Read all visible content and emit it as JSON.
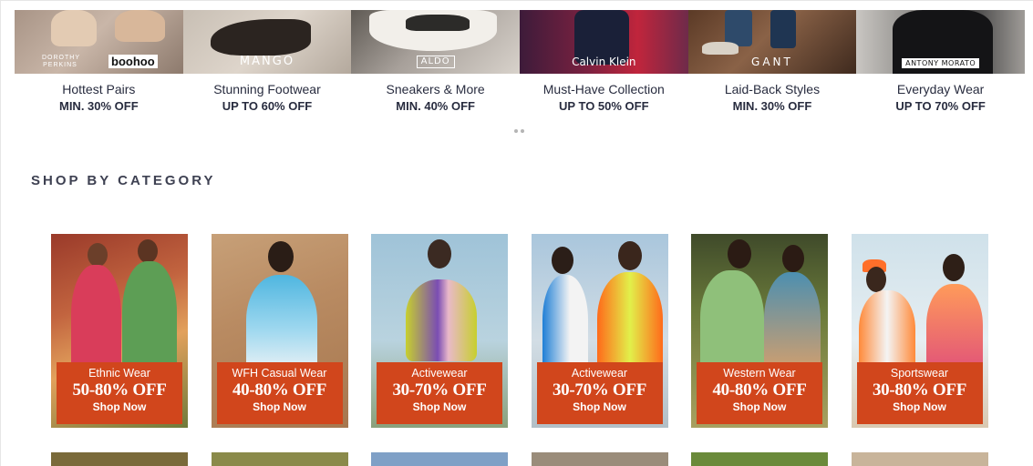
{
  "brands": [
    {
      "logo": "boohoo",
      "logo_secondary": "DOROTHY PERKINS",
      "title": "Hottest Pairs",
      "offer": "MIN. 30% OFF"
    },
    {
      "logo": "MANGO",
      "title": "Stunning Footwear",
      "offer": "UP TO 60% OFF"
    },
    {
      "logo": "ALDO",
      "title": "Sneakers & More",
      "offer": "MIN. 40% OFF"
    },
    {
      "logo": "Calvin Klein",
      "title": "Must-Have Collection",
      "offer": "UP TO 50% OFF"
    },
    {
      "logo": "GANT",
      "title": "Laid-Back Styles",
      "offer": "MIN. 30% OFF"
    },
    {
      "logo": "ANTONY MORATO",
      "title": "Everyday Wear",
      "offer": "UP TO 70% OFF"
    }
  ],
  "section_title": "SHOP BY CATEGORY",
  "categories": [
    {
      "name": "Ethnic Wear",
      "discount": "50-80% OFF",
      "cta": "Shop Now"
    },
    {
      "name": "WFH Casual Wear",
      "discount": "40-80% OFF",
      "cta": "Shop Now"
    },
    {
      "name": "Activewear",
      "discount": "30-70% OFF",
      "cta": "Shop Now"
    },
    {
      "name": "Activewear",
      "discount": "30-70% OFF",
      "cta": "Shop Now"
    },
    {
      "name": "Western Wear",
      "discount": "40-80% OFF",
      "cta": "Shop Now"
    },
    {
      "name": "Sportswear",
      "discount": "30-80% OFF",
      "cta": "Shop Now"
    }
  ],
  "colors": {
    "panel": "#d1461c",
    "text": "#282c3f",
    "dot": "#b5b5b5"
  }
}
